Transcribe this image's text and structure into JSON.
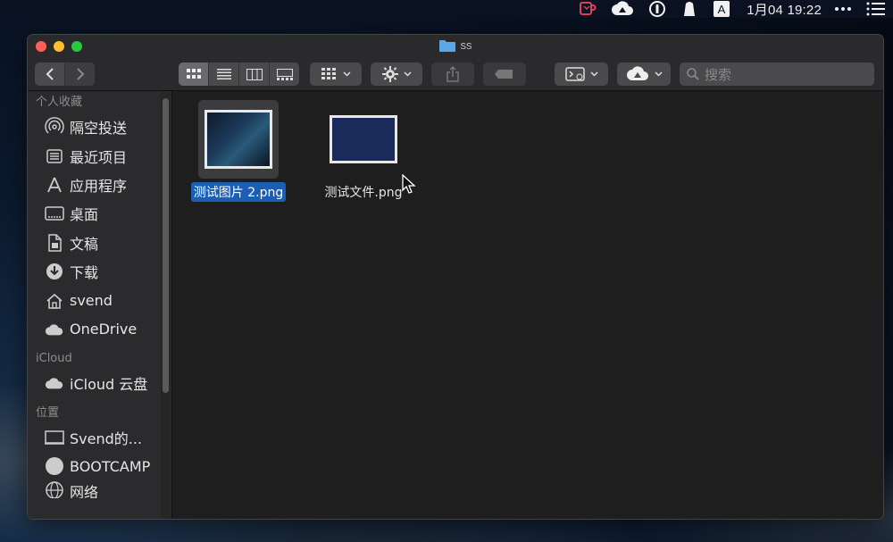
{
  "menubar": {
    "clock": "1月04 19:22",
    "input_method": "A",
    "icons": [
      "coffee-cup-icon",
      "creative-cloud-icon",
      "password-icon",
      "bell-shape-icon",
      "input-method-icon",
      "more-icon",
      "list-icon"
    ]
  },
  "window": {
    "title": "ss"
  },
  "toolbar": {
    "search_placeholder": "搜索",
    "view_modes": [
      "icon-view",
      "list-view",
      "column-view",
      "gallery-view"
    ],
    "active_view": "icon-view"
  },
  "sidebar": {
    "sections": [
      {
        "heading": "个人收藏",
        "items": [
          {
            "label": "隔空投送",
            "icon": "airdrop-icon"
          },
          {
            "label": "最近项目",
            "icon": "recents-icon"
          },
          {
            "label": "应用程序",
            "icon": "applications-icon"
          },
          {
            "label": "桌面",
            "icon": "desktop-icon"
          },
          {
            "label": "文稿",
            "icon": "documents-icon"
          },
          {
            "label": "下载",
            "icon": "downloads-icon"
          },
          {
            "label": "svend",
            "icon": "home-icon"
          },
          {
            "label": "OneDrive",
            "icon": "cloud-icon"
          }
        ]
      },
      {
        "heading": "iCloud",
        "items": [
          {
            "label": "iCloud 云盘",
            "icon": "icloud-icon"
          }
        ]
      },
      {
        "heading": "位置",
        "items": [
          {
            "label": "Svend的...",
            "icon": "computer-icon"
          },
          {
            "label": "BOOTCAMP",
            "icon": "disk-icon"
          },
          {
            "label": "网络",
            "icon": "network-icon"
          }
        ]
      }
    ]
  },
  "files": [
    {
      "name": "测试图片 2.png",
      "selected": true
    },
    {
      "name": "测试文件.png",
      "selected": false
    }
  ],
  "colors": {
    "selection": "#1a5fb4",
    "window_bg": "#1e1e1e",
    "sidebar_bg": "#2b2b2d"
  }
}
